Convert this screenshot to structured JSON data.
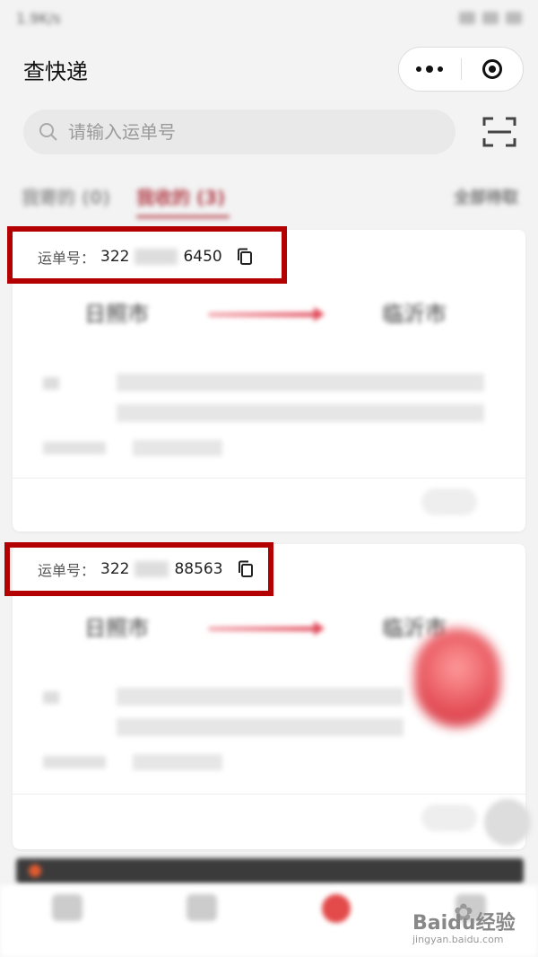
{
  "status_bar": {
    "left_text": "1.9K/s",
    "center_text": ""
  },
  "header": {
    "title": "查快递"
  },
  "search": {
    "placeholder": "请输入运单号"
  },
  "tabs": {
    "sent": "我寄的 (0)",
    "received": "我收的 (3)",
    "right": "全部待取"
  },
  "cards": [
    {
      "waybill_label": "运单号：",
      "waybill_prefix": "322",
      "waybill_suffix": "6450",
      "from_city": "日照市",
      "to_city": "临沂市"
    },
    {
      "waybill_label": "运单号：",
      "waybill_prefix": "322",
      "waybill_suffix": "88563",
      "from_city": "日照市",
      "to_city": "临沂市"
    }
  ],
  "notice": {
    "text": ""
  },
  "watermark": {
    "brand": "Baidu经验",
    "url": "jingyan.baidu.com"
  },
  "colors": {
    "accent": "#b2414c",
    "highlight": "#b30000"
  }
}
